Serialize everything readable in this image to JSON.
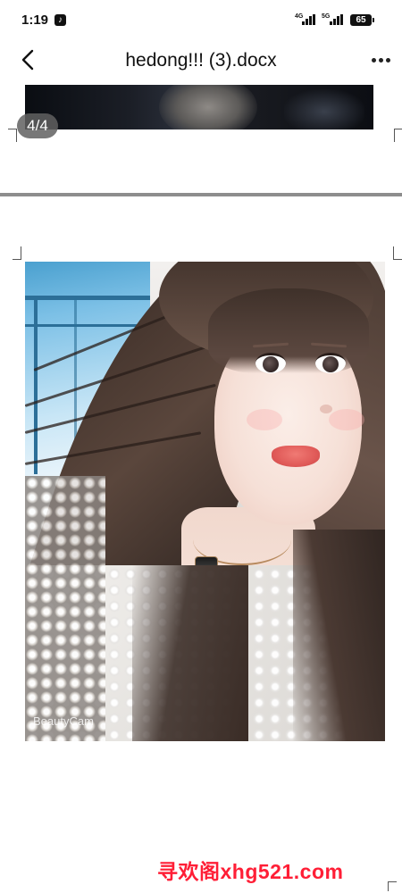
{
  "status_bar": {
    "time": "1:19",
    "app_notification": "♪",
    "network_1": "4G",
    "network_2": "5G",
    "battery": "65"
  },
  "app_bar": {
    "title": "hedong!!! (3).docx",
    "back_icon": "chevron-left-icon",
    "more_icon": "more-horizontal-icon"
  },
  "document": {
    "page_indicator": "4/4",
    "pages": [
      {
        "content": "photo-bottom-edge"
      },
      {
        "content": "selfie-photo",
        "photo_watermark": "BeautyCam"
      }
    ]
  },
  "overlay": {
    "watermark_text": "寻欢阁xhg521.com",
    "watermark_color": "#ff1e36"
  }
}
